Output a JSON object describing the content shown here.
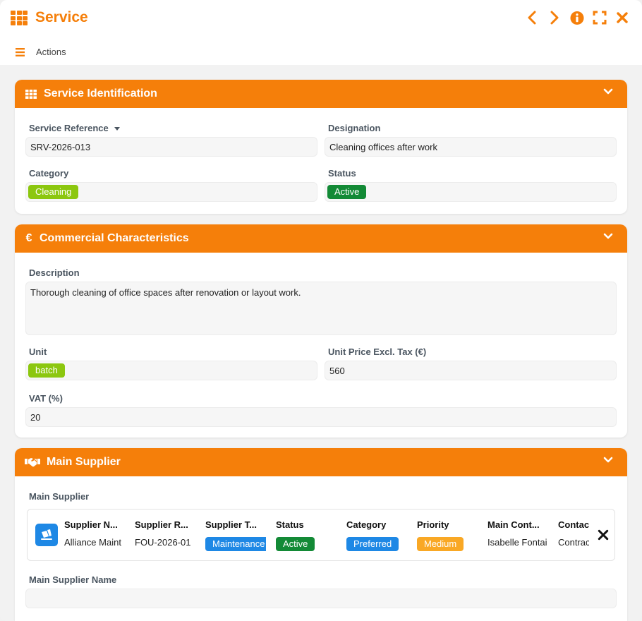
{
  "app": {
    "title": "Service",
    "actions_label": "Actions"
  },
  "colors": {
    "accent": "#f57f0a",
    "green_tag": "#8cc70f",
    "dark_green": "#138a36",
    "blue": "#1e88e5",
    "amber": "#f9a825"
  },
  "icons": {
    "app": "grid-icon",
    "prev": "chevron-left-icon",
    "next": "chevron-right-icon",
    "info": "info-icon",
    "expand": "expand-icon",
    "close": "close-icon",
    "menu": "hamburger-icon"
  },
  "identification": {
    "title": "Service Identification",
    "service_reference_label": "Service Reference",
    "service_reference": "SRV-2026-013",
    "designation_label": "Designation",
    "designation": "Cleaning offices after work",
    "category_label": "Category",
    "category": "Cleaning",
    "status_label": "Status",
    "status": "Active"
  },
  "commercial": {
    "title": "Commercial Characteristics",
    "description_label": "Description",
    "description": "Thorough cleaning of office spaces after renovation or layout work.",
    "unit_label": "Unit",
    "unit": "batch",
    "price_label": "Unit Price Excl. Tax (€)",
    "price": "560",
    "vat_label": "VAT (%)",
    "vat": "20"
  },
  "supplier": {
    "title": "Main Supplier",
    "main_supplier_label": "Main Supplier",
    "columns": {
      "name": {
        "header": "Supplier N...",
        "value": "Alliance Maint"
      },
      "ref": {
        "header": "Supplier R...",
        "value": "FOU-2026-01"
      },
      "type": {
        "header": "Supplier T...",
        "value": "Maintenance"
      },
      "status": {
        "header": "Status",
        "value": "Active"
      },
      "category": {
        "header": "Category",
        "value": "Preferred"
      },
      "priority": {
        "header": "Priority",
        "value": "Medium"
      },
      "contact": {
        "header": "Main Cont...",
        "value": "Isabelle Fontai"
      },
      "contact2": {
        "header": "Contac",
        "value": "Contrac"
      }
    },
    "main_supplier_name_label": "Main Supplier Name",
    "main_supplier_name": ""
  }
}
